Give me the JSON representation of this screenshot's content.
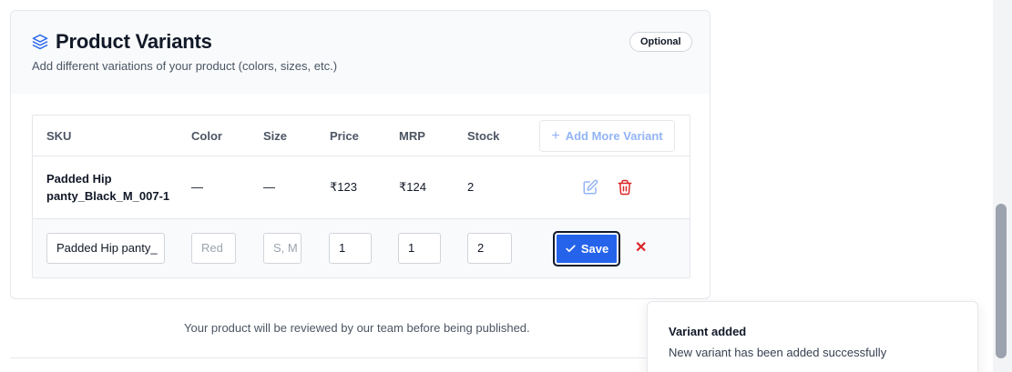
{
  "section": {
    "title": "Product Variants",
    "subtitle": "Add different variations of your product (colors, sizes, etc.)",
    "badge": "Optional",
    "title_icon": "layers-icon"
  },
  "table": {
    "columns": [
      "SKU",
      "Color",
      "Size",
      "Price",
      "MRP",
      "Stock"
    ],
    "add_button_label": "Add More Variant",
    "rows": [
      {
        "sku_line1": "Padded Hip",
        "sku_line2": "panty_Black_M_007-1",
        "color": "—",
        "size": "—",
        "price": "₹123",
        "mrp": "₹124",
        "stock": "2"
      }
    ],
    "edit_row": {
      "sku_value": "Padded Hip panty_",
      "color_placeholder": "Red",
      "size_placeholder": "S, M",
      "price_value": "1",
      "mrp_value": "1",
      "stock_value": "2",
      "save_label": "Save",
      "cancel_glyph": "✕"
    }
  },
  "footer": {
    "review_text": "Your product will be reviewed by our team before being published."
  },
  "toast": {
    "title": "Variant added",
    "message": "New variant has been added successfully"
  },
  "colors": {
    "accent": "#2563eb",
    "danger": "#dc2626",
    "header_bg": "#f8fafc"
  }
}
